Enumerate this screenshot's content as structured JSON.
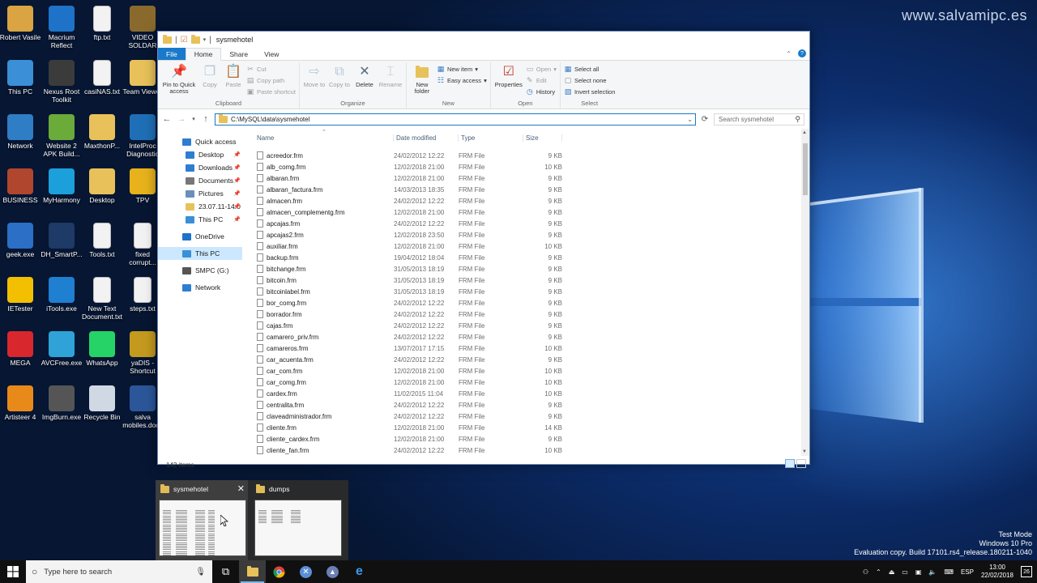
{
  "watermark": "www.salvamipc.es",
  "evaluation": [
    "Test Mode",
    "Windows 10 Pro",
    "Evaluation copy. Build 17101.rs4_release.180211-1040"
  ],
  "desktop_icons": [
    {
      "label": "Robert Vasile",
      "icon": "user-folder-icon",
      "color": "#d9a441"
    },
    {
      "label": "Macrium Reflect",
      "icon": "macrium-icon",
      "color": "#1e73c8"
    },
    {
      "label": "ftp.txt",
      "icon": "text-file-icon",
      "color": "#f2f2f2"
    },
    {
      "label": "VIDEO SOLDAR",
      "icon": "folder-icon",
      "color": "#8a6a2c"
    },
    {
      "label": "This PC",
      "icon": "computer-icon",
      "color": "#3a8fd6"
    },
    {
      "label": "Nexus Root Toolkit",
      "icon": "nexus-icon",
      "color": "#3b3b3b"
    },
    {
      "label": "casiNAS.txt",
      "icon": "text-file-icon",
      "color": "#f2f2f2"
    },
    {
      "label": "Team Viewer",
      "icon": "folder-icon",
      "color": "#e8c15a"
    },
    {
      "label": "Network",
      "icon": "network-icon",
      "color": "#2f7dc4"
    },
    {
      "label": "Website 2 APK Build...",
      "icon": "android-icon",
      "color": "#6aab3a"
    },
    {
      "label": "MaxthonP...",
      "icon": "folder-icon",
      "color": "#e8c15a"
    },
    {
      "label": "IntelProc Diagnostic",
      "icon": "intel-icon",
      "color": "#1f6fb6"
    },
    {
      "label": "BUSINESS",
      "icon": "business-folder-icon",
      "color": "#b0462e"
    },
    {
      "label": "MyHarmony",
      "icon": "harmony-icon",
      "color": "#1ca0dc"
    },
    {
      "label": "Desktop",
      "icon": "folder-icon",
      "color": "#e8c15a"
    },
    {
      "label": "TPV",
      "icon": "tpv-icon",
      "color": "#e7b21b"
    },
    {
      "label": "geek.exe",
      "icon": "geek-icon",
      "color": "#2b6fc6"
    },
    {
      "label": "DH_SmartP...",
      "icon": "dh-icon",
      "color": "#1e3a66"
    },
    {
      "label": "Tools.txt",
      "icon": "text-file-icon",
      "color": "#f2f2f2"
    },
    {
      "label": "fixed corrupt...",
      "icon": "text-file-icon",
      "color": "#f2f2f2"
    },
    {
      "label": "IETester",
      "icon": "ietester-icon",
      "color": "#f2c000"
    },
    {
      "label": "iTools.exe",
      "icon": "itools-icon",
      "color": "#1f7fd1"
    },
    {
      "label": "New Text Document.txt",
      "icon": "text-file-icon",
      "color": "#f2f2f2"
    },
    {
      "label": "steps.txt",
      "icon": "text-file-icon",
      "color": "#f2f2f2"
    },
    {
      "label": "MEGA",
      "icon": "mega-icon",
      "color": "#d9272e"
    },
    {
      "label": "AVCFree.exe",
      "icon": "avc-icon",
      "color": "#2fa3d8"
    },
    {
      "label": "WhatsApp",
      "icon": "whatsapp-icon",
      "color": "#25d366"
    },
    {
      "label": "yaDIS - Shortcut",
      "icon": "yadis-icon",
      "color": "#c49a1e"
    },
    {
      "label": "Artisteer 4",
      "icon": "artisteer-icon",
      "color": "#e88a1a"
    },
    {
      "label": "ImgBurn.exe",
      "icon": "imgburn-icon",
      "color": "#555555"
    },
    {
      "label": "Recycle Bin",
      "icon": "recycle-bin-icon",
      "color": "#cfd8e3"
    },
    {
      "label": "salva mobiles.docx",
      "icon": "word-doc-icon",
      "color": "#2b579a"
    }
  ],
  "explorer": {
    "title": "sysmehotel",
    "tabs": [
      "File",
      "Home",
      "Share",
      "View"
    ],
    "ribbon": {
      "clipboard": {
        "label": "Clipboard",
        "pin": "Pin to Quick access",
        "copy": "Copy",
        "paste": "Paste",
        "cut": "Cut",
        "copy_path": "Copy path",
        "paste_shortcut": "Paste shortcut"
      },
      "organize": {
        "label": "Organize",
        "move_to": "Move to",
        "copy_to": "Copy to",
        "delete": "Delete",
        "rename": "Rename"
      },
      "new": {
        "label": "New",
        "new_folder": "New folder",
        "new_item": "New item",
        "easy_access": "Easy access"
      },
      "open": {
        "label": "Open",
        "properties": "Properties",
        "open": "Open",
        "edit": "Edit",
        "history": "History"
      },
      "select": {
        "label": "Select",
        "select_all": "Select all",
        "select_none": "Select none",
        "invert": "Invert selection"
      }
    },
    "address": "C:\\MySQL\\data\\sysmehotel",
    "search_placeholder": "Search sysmehotel",
    "nav": [
      {
        "label": "Quick access",
        "icon": "star-icon",
        "indent": 0,
        "pinned": false
      },
      {
        "label": "Desktop",
        "icon": "desktop-icon",
        "indent": 1,
        "pinned": true
      },
      {
        "label": "Downloads",
        "icon": "downloads-icon",
        "indent": 1,
        "pinned": true
      },
      {
        "label": "Documents",
        "icon": "documents-icon",
        "indent": 1,
        "pinned": true
      },
      {
        "label": "Pictures",
        "icon": "pictures-icon",
        "indent": 1,
        "pinned": true
      },
      {
        "label": "23.07.11-14.0",
        "icon": "folder-icon",
        "indent": 1,
        "pinned": true
      },
      {
        "label": "This PC",
        "icon": "computer-icon",
        "indent": 1,
        "pinned": true
      },
      {
        "label": "",
        "icon": "",
        "indent": 0,
        "pinned": false
      },
      {
        "label": "OneDrive",
        "icon": "onedrive-icon",
        "indent": 0,
        "pinned": false
      },
      {
        "label": "",
        "icon": "",
        "indent": 0,
        "pinned": false
      },
      {
        "label": "This PC",
        "icon": "computer-icon",
        "indent": 0,
        "pinned": false,
        "selected": true
      },
      {
        "label": "",
        "icon": "",
        "indent": 0,
        "pinned": false
      },
      {
        "label": "SMPC (G:)",
        "icon": "drive-icon",
        "indent": 0,
        "pinned": false
      },
      {
        "label": "",
        "icon": "",
        "indent": 0,
        "pinned": false
      },
      {
        "label": "Network",
        "icon": "network-icon",
        "indent": 0,
        "pinned": false
      }
    ],
    "columns": {
      "name": "Name",
      "date": "Date modified",
      "type": "Type",
      "size": "Size"
    },
    "files": [
      {
        "name": "acreedor.frm",
        "date": "24/02/2012 12:22",
        "type": "FRM File",
        "size": "9 KB"
      },
      {
        "name": "alb_comg.frm",
        "date": "12/02/2018 21:00",
        "type": "FRM File",
        "size": "10 KB"
      },
      {
        "name": "albaran.frm",
        "date": "12/02/2018 21:00",
        "type": "FRM File",
        "size": "9 KB"
      },
      {
        "name": "albaran_factura.frm",
        "date": "14/03/2013 18:35",
        "type": "FRM File",
        "size": "9 KB"
      },
      {
        "name": "almacen.frm",
        "date": "24/02/2012 12:22",
        "type": "FRM File",
        "size": "9 KB"
      },
      {
        "name": "almacen_complementg.frm",
        "date": "12/02/2018 21:00",
        "type": "FRM File",
        "size": "9 KB"
      },
      {
        "name": "apcajas.frm",
        "date": "24/02/2012 12:22",
        "type": "FRM File",
        "size": "9 KB"
      },
      {
        "name": "apcajas2.frm",
        "date": "12/02/2018 23:50",
        "type": "FRM File",
        "size": "9 KB"
      },
      {
        "name": "auxiliar.frm",
        "date": "12/02/2018 21:00",
        "type": "FRM File",
        "size": "10 KB"
      },
      {
        "name": "backup.frm",
        "date": "19/04/2012 18:04",
        "type": "FRM File",
        "size": "9 KB"
      },
      {
        "name": "bitchange.frm",
        "date": "31/05/2013 18:19",
        "type": "FRM File",
        "size": "9 KB"
      },
      {
        "name": "bitcoin.frm",
        "date": "31/05/2013 18:19",
        "type": "FRM File",
        "size": "9 KB"
      },
      {
        "name": "bitcoinlabel.frm",
        "date": "31/05/2013 18:19",
        "type": "FRM File",
        "size": "9 KB"
      },
      {
        "name": "bor_comg.frm",
        "date": "24/02/2012 12:22",
        "type": "FRM File",
        "size": "9 KB"
      },
      {
        "name": "borrador.frm",
        "date": "24/02/2012 12:22",
        "type": "FRM File",
        "size": "9 KB"
      },
      {
        "name": "cajas.frm",
        "date": "24/02/2012 12:22",
        "type": "FRM File",
        "size": "9 KB"
      },
      {
        "name": "camarero_priv.frm",
        "date": "24/02/2012 12:22",
        "type": "FRM File",
        "size": "9 KB"
      },
      {
        "name": "camareros.frm",
        "date": "13/07/2017 17:15",
        "type": "FRM File",
        "size": "10 KB"
      },
      {
        "name": "car_acuenta.frm",
        "date": "24/02/2012 12:22",
        "type": "FRM File",
        "size": "9 KB"
      },
      {
        "name": "car_com.frm",
        "date": "12/02/2018 21:00",
        "type": "FRM File",
        "size": "10 KB"
      },
      {
        "name": "car_comg.frm",
        "date": "12/02/2018 21:00",
        "type": "FRM File",
        "size": "10 KB"
      },
      {
        "name": "cardex.frm",
        "date": "11/02/2015 11:04",
        "type": "FRM File",
        "size": "10 KB"
      },
      {
        "name": "centralita.frm",
        "date": "24/02/2012 12:22",
        "type": "FRM File",
        "size": "9 KB"
      },
      {
        "name": "claveadministrador.frm",
        "date": "24/02/2012 12:22",
        "type": "FRM File",
        "size": "9 KB"
      },
      {
        "name": "cliente.frm",
        "date": "12/02/2018 21:00",
        "type": "FRM File",
        "size": "14 KB"
      },
      {
        "name": "cliente_cardex.frm",
        "date": "12/02/2018 21:00",
        "type": "FRM File",
        "size": "9 KB"
      },
      {
        "name": "cliente_fan.frm",
        "date": "24/02/2012 12:22",
        "type": "FRM File",
        "size": "10 KB"
      }
    ],
    "status": "142 items"
  },
  "thumbnails": [
    {
      "title": "sysmehotel",
      "close": "✕"
    },
    {
      "title": "dumps"
    }
  ],
  "taskbar": {
    "search_placeholder": "Type here to search",
    "apps": [
      "task-view-icon",
      "file-explorer-icon",
      "chrome-icon",
      "xmind-icon",
      "app-icon",
      "edge-icon"
    ],
    "language": "ESP",
    "time": "13:00",
    "date": "22/02/2018",
    "notifications": "26"
  },
  "colors": {
    "accent": "#1979ca",
    "selection": "#cce8ff",
    "taskbar": "#101010"
  }
}
